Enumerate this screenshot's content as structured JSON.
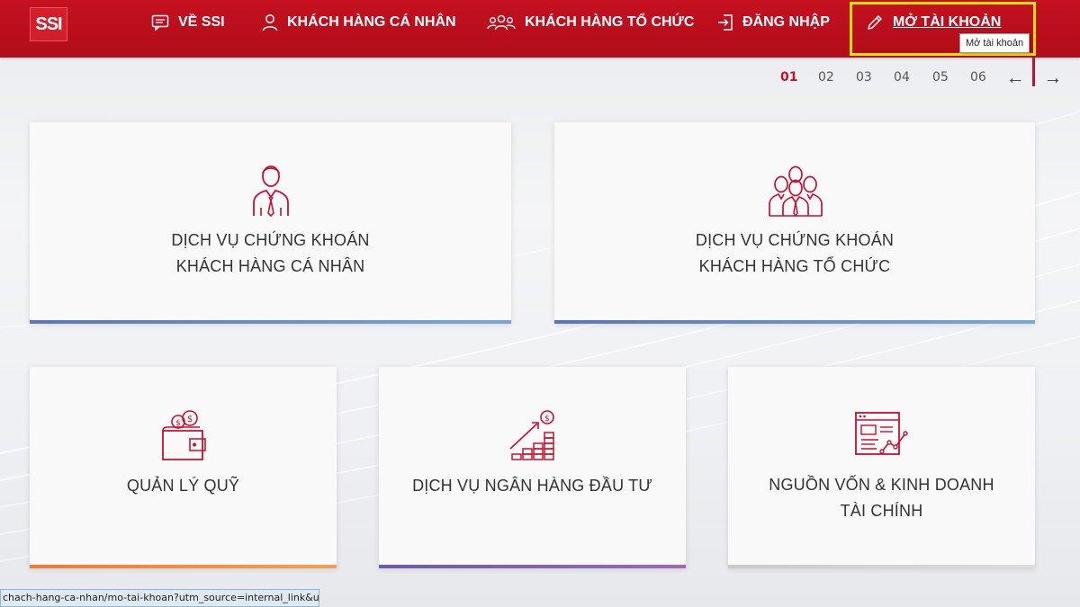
{
  "logo": {
    "text": "SSI"
  },
  "nav": {
    "about": "VỀ SSI",
    "personal": "KHÁCH HÀNG CÁ NHÂN",
    "corporate": "KHÁCH HÀNG TỔ CHỨC",
    "login": "ĐĂNG NHẬP",
    "open_account": "MỞ TÀI KHOẢN"
  },
  "tooltip": "Mở tài khoản",
  "pager": {
    "pages": [
      "01",
      "02",
      "03",
      "04",
      "05",
      "06"
    ],
    "active": "01",
    "prev": "←",
    "next": "→"
  },
  "cards": {
    "personal": {
      "line1": "DỊCH VỤ CHỨNG KHOÁN",
      "line2": "KHÁCH HÀNG CÁ NHÂN"
    },
    "corporate": {
      "line1": "DỊCH VỤ CHỨNG KHOÁN",
      "line2": "KHÁCH HÀNG TỔ CHỨC"
    },
    "fund": {
      "line1": "QUẢN LÝ QUỸ"
    },
    "banking": {
      "line1": "DỊCH VỤ NGÂN HÀNG ĐẦU TƯ"
    },
    "capital": {
      "line1": "NGUỒN VỐN & KINH DOANH",
      "line2": "TÀI CHÍNH"
    }
  },
  "status_bar": {
    "url": "chach-hang-ca-nhan/mo-tai-khoan?utm_source=internal_link&utm_..."
  },
  "colors": {
    "brand_red": "#c5101f",
    "accent_blue": "#5a7fb8",
    "accent_orange": "#f08a3c",
    "accent_purple": "#7a5aa6",
    "highlight": "#f2e203"
  }
}
